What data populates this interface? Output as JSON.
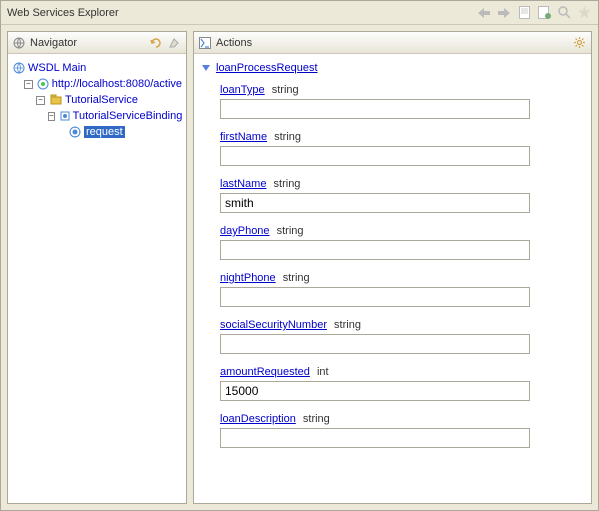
{
  "window": {
    "title": "Web Services Explorer"
  },
  "navigator": {
    "title": "Navigator",
    "tree": {
      "root": "WSDL Main",
      "endpoint": "http://localhost:8080/active",
      "service": "TutorialService",
      "binding": "TutorialServiceBinding",
      "operation": "request"
    }
  },
  "actions": {
    "title": "Actions",
    "section": "loanProcessRequest",
    "fields": [
      {
        "name": "loanType",
        "type": "string",
        "value": ""
      },
      {
        "name": "firstName",
        "type": "string",
        "value": ""
      },
      {
        "name": "lastName",
        "type": "string",
        "value": "smith"
      },
      {
        "name": "dayPhone",
        "type": "string",
        "value": ""
      },
      {
        "name": "nightPhone",
        "type": "string",
        "value": ""
      },
      {
        "name": "socialSecurityNumber",
        "type": "string",
        "value": ""
      },
      {
        "name": "amountRequested",
        "type": "int",
        "value": "15000"
      },
      {
        "name": "loanDescription",
        "type": "string",
        "value": ""
      }
    ]
  }
}
